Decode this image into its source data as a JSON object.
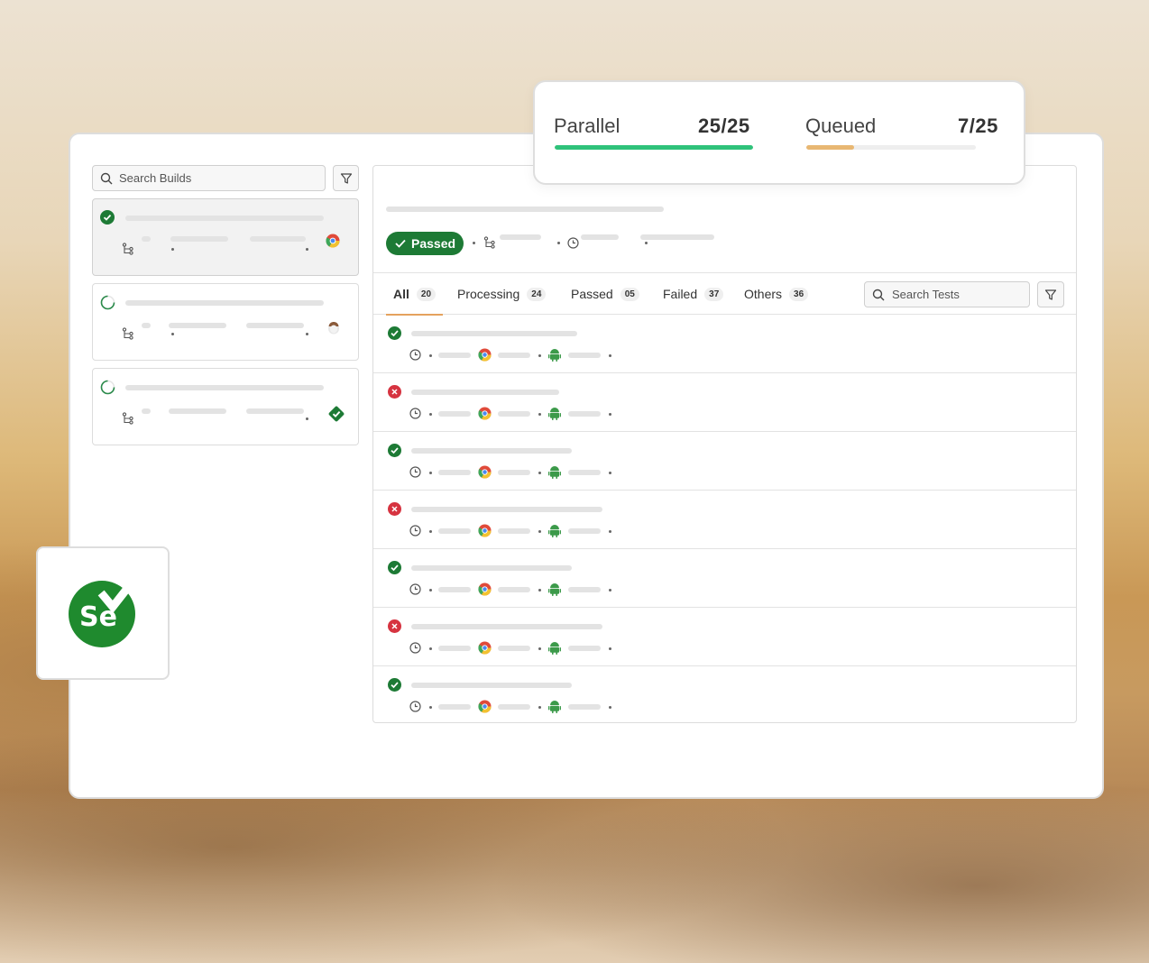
{
  "builds": {
    "search_placeholder": "Search Builds",
    "items": [
      {
        "status": "passed",
        "active": true,
        "app_icon": "chrome-icon"
      },
      {
        "status": "running",
        "active": false,
        "app_icon": "safari-icon"
      },
      {
        "status": "running",
        "active": false,
        "app_icon": "check-badge-icon"
      }
    ]
  },
  "build_detail": {
    "status_label": "Passed"
  },
  "tabs": [
    {
      "label": "All",
      "count": "20",
      "active": true
    },
    {
      "label": "Processing",
      "count": "24",
      "active": false
    },
    {
      "label": "Passed",
      "count": "05",
      "active": false
    },
    {
      "label": "Failed",
      "count": "37",
      "active": false
    },
    {
      "label": "Others",
      "count": "36",
      "active": false
    }
  ],
  "tests": {
    "search_placeholder": "Search Tests",
    "rows": [
      {
        "status": "passed"
      },
      {
        "status": "failed"
      },
      {
        "status": "passed"
      },
      {
        "status": "failed"
      },
      {
        "status": "passed"
      },
      {
        "status": "failed"
      },
      {
        "status": "passed"
      }
    ]
  },
  "stats": {
    "parallel": {
      "label": "Parallel",
      "value": "25/25",
      "fraction": 1.0,
      "color": "#2fc27a"
    },
    "queued": {
      "label": "Queued",
      "value": "7/25",
      "fraction": 0.28,
      "color": "#e8b772"
    }
  },
  "colors": {
    "passed": "#1d7a35",
    "failed": "#d63340",
    "accent_tab": "#e5a25e"
  },
  "logo": {
    "name": "selenium-logo",
    "text": "Se"
  }
}
